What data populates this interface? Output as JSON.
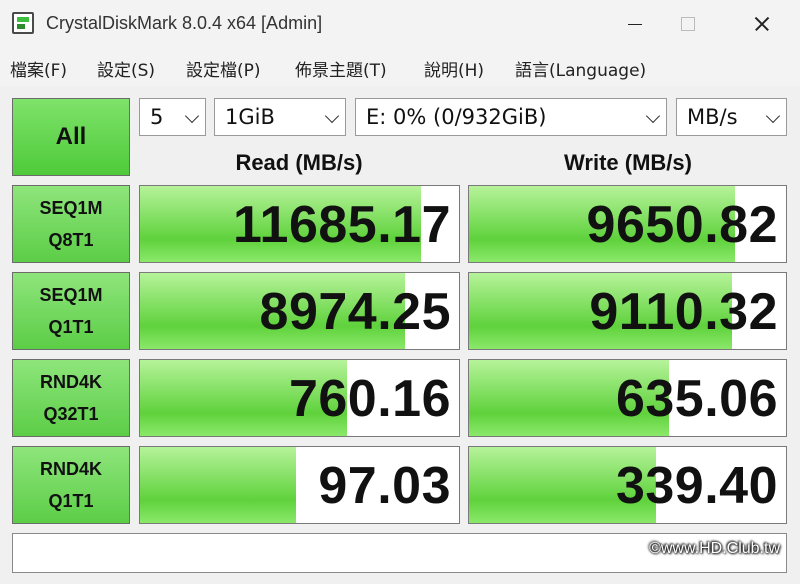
{
  "window": {
    "title": "CrystalDiskMark 8.0.4 x64 [Admin]"
  },
  "menu": [
    "檔案(F)",
    "設定(S)",
    "設定檔(P)",
    "佈景主題(T)",
    "說明(H)",
    "語言(Language)"
  ],
  "controls": {
    "all_label": "All",
    "count": "5",
    "size": "1GiB",
    "drive": "E: 0% (0/932GiB)",
    "unit": "MB/s"
  },
  "headers": {
    "read": "Read (MB/s)",
    "write": "Write (MB/s)"
  },
  "rows": [
    {
      "line1": "SEQ1M",
      "line2": "Q8T1",
      "read": "11685.17",
      "write": "9650.82",
      "read_fill": 0.88,
      "write_fill": 0.84
    },
    {
      "line1": "SEQ1M",
      "line2": "Q1T1",
      "read": "8974.25",
      "write": "9110.32",
      "read_fill": 0.83,
      "write_fill": 0.83
    },
    {
      "line1": "RND4K",
      "line2": "Q32T1",
      "read": "760.16",
      "write": "635.06",
      "read_fill": 0.65,
      "write_fill": 0.63
    },
    {
      "line1": "RND4K",
      "line2": "Q1T1",
      "read": "97.03",
      "write": "339.40",
      "read_fill": 0.49,
      "write_fill": 0.59
    }
  ],
  "watermark": "©www.HD.Club.tw",
  "colors": {
    "accent_green": "#5fd23c"
  }
}
